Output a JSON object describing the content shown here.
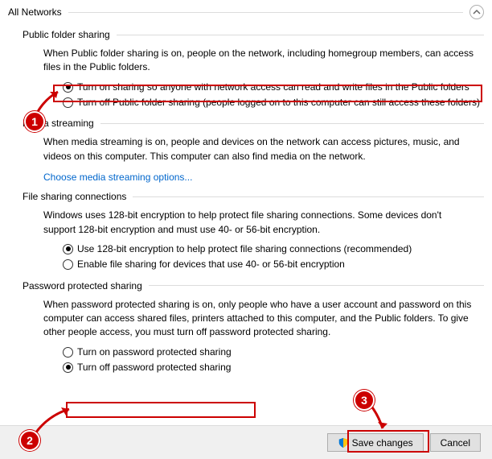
{
  "header": {
    "title": "All Networks"
  },
  "sections": {
    "pfs": {
      "title": "Public folder sharing",
      "desc": "When Public folder sharing is on, people on the network, including homegroup members, can access files in the Public folders.",
      "opt1": "Turn on sharing so anyone with network access can read and write files in the Public folders",
      "opt2": "Turn off Public folder sharing (people logged on to this computer can still access these folders)"
    },
    "ms": {
      "title": "Media streaming",
      "desc": "When media streaming is on, people and devices on the network can access pictures, music, and videos on this computer. This computer can also find media on the network.",
      "link": "Choose media streaming options..."
    },
    "fsc": {
      "title": "File sharing connections",
      "desc": "Windows uses 128-bit encryption to help protect file sharing connections. Some devices don't support 128-bit encryption and must use 40- or 56-bit encryption.",
      "opt1": "Use 128-bit encryption to help protect file sharing connections (recommended)",
      "opt2": "Enable file sharing for devices that use 40- or 56-bit encryption"
    },
    "pps": {
      "title": "Password protected sharing",
      "desc": "When password protected sharing is on, only people who have a user account and password on this computer can access shared files, printers attached to this computer, and the Public folders. To give other people access, you must turn off password protected sharing.",
      "opt1": "Turn on password protected sharing",
      "opt2": "Turn off password protected sharing"
    }
  },
  "footer": {
    "save": "Save changes",
    "cancel": "Cancel"
  },
  "annotations": {
    "a1": "1",
    "a2": "2",
    "a3": "3"
  }
}
